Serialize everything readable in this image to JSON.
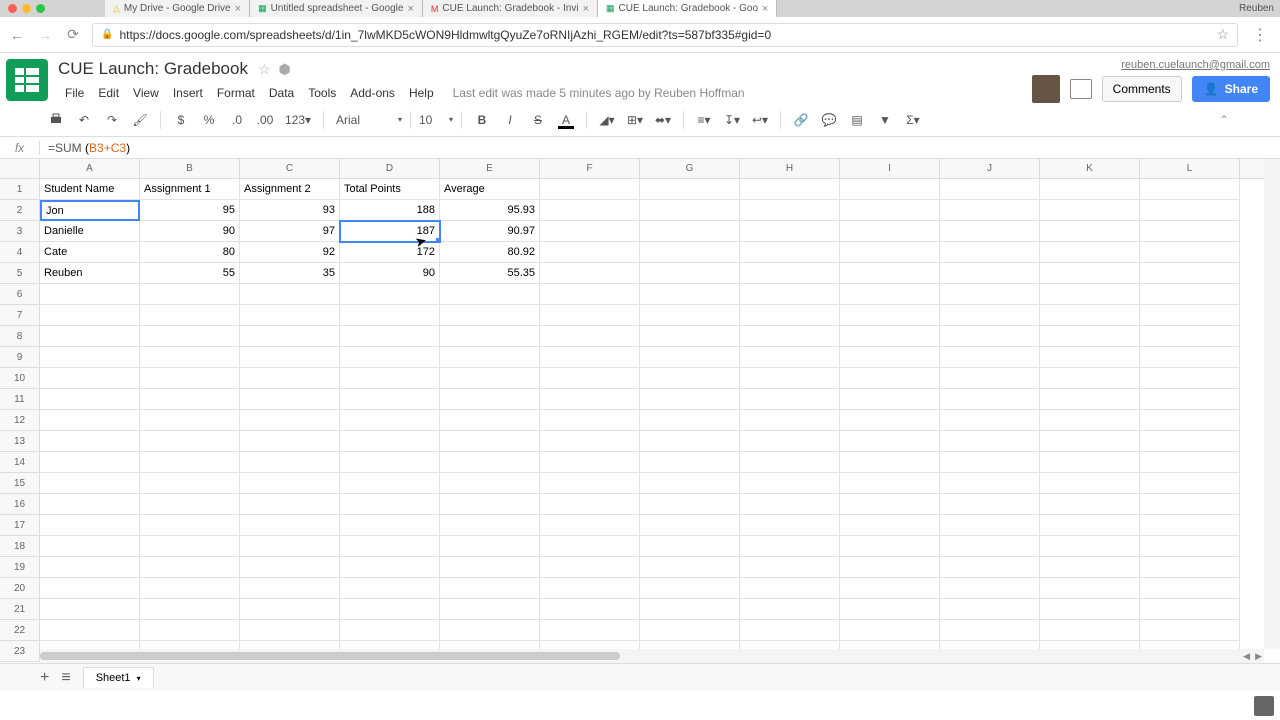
{
  "browser": {
    "profile": "Reuben",
    "tabs": [
      {
        "icon": "drive",
        "label": "My Drive - Google Drive"
      },
      {
        "icon": "sheets",
        "label": "Untitled spreadsheet - Google"
      },
      {
        "icon": "gmail",
        "label": "CUE Launch: Gradebook - Invi"
      },
      {
        "icon": "sheets",
        "label": "CUE Launch: Gradebook - Goo",
        "active": true
      }
    ],
    "url": "https://docs.google.com/spreadsheets/d/1in_7lwMKD5cWON9HldmwltgQyuZe7oRNIjAzhi_RGEM/edit?ts=587bf335#gid=0"
  },
  "header": {
    "title": "CUE Launch: Gradebook",
    "menus": [
      "File",
      "Edit",
      "View",
      "Insert",
      "Format",
      "Data",
      "Tools",
      "Add-ons",
      "Help"
    ],
    "last_edit": "Last edit was made 5 minutes ago by Reuben Hoffman",
    "user_email": "reuben.cuelaunch@gmail.com",
    "comments_label": "Comments",
    "share_label": "Share"
  },
  "toolbar": {
    "font": "Arial",
    "size": "10",
    "num_format": "123"
  },
  "formula": {
    "fn": "=SUM",
    "open": " (",
    "ref": "B3+C3",
    "close": ")"
  },
  "grid": {
    "columns": [
      "A",
      "B",
      "C",
      "D",
      "E",
      "F",
      "G",
      "H",
      "I",
      "J",
      "K",
      "L"
    ],
    "headers": [
      "Student Name",
      "Assignment 1",
      "Assignment 2",
      "Total Points",
      "Average"
    ],
    "data_rows": [
      {
        "name": "Jon",
        "a1": "95",
        "a2": "93",
        "total": "188",
        "avg": "95.93"
      },
      {
        "name": "Danielle",
        "a1": "90",
        "a2": "97",
        "total": "187",
        "avg": "90.97"
      },
      {
        "name": "Cate",
        "a1": "80",
        "a2": "92",
        "total": "172",
        "avg": "80.92"
      },
      {
        "name": "Reuben",
        "a1": "55",
        "a2": "35",
        "total": "90",
        "avg": "55.35"
      }
    ],
    "total_rows": 23,
    "selected_cell": "A2",
    "active_cell": "D3"
  },
  "sheet": {
    "name": "Sheet1"
  }
}
